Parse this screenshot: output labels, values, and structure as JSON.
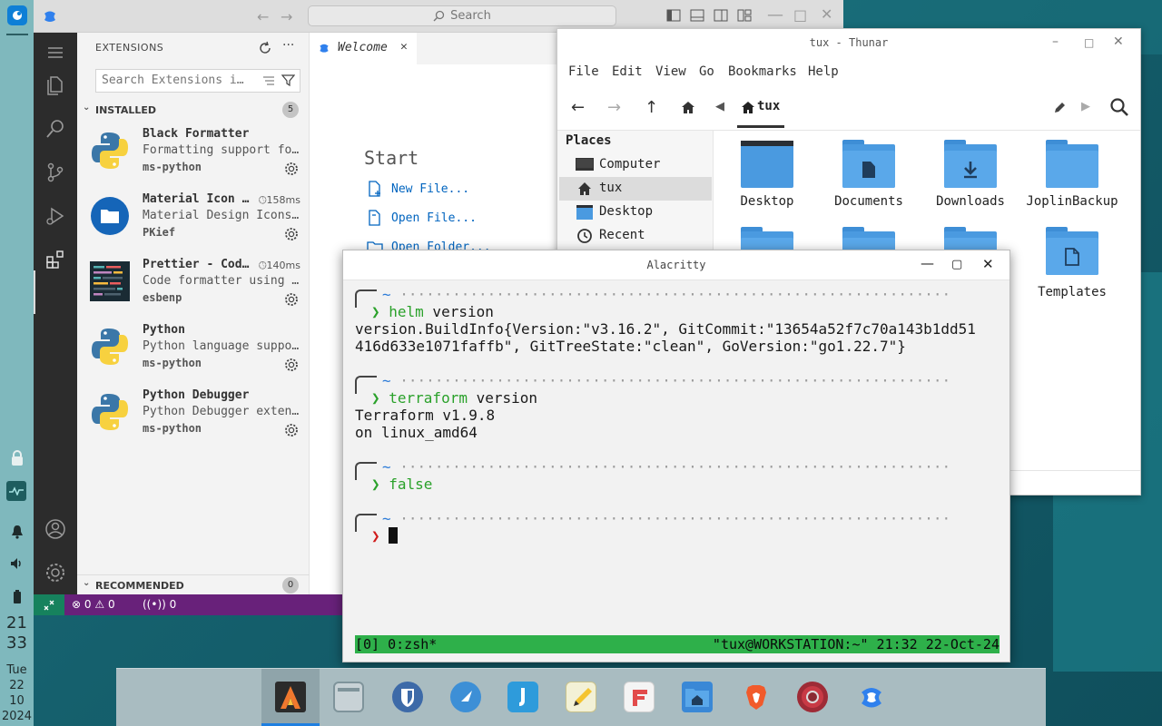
{
  "panel": {
    "clock_hour": "21",
    "clock_minute": "33",
    "date_day": "Tue",
    "date_dd": "22",
    "date_mm": "10",
    "date_yyyy": "2024"
  },
  "vscode": {
    "search_placeholder": "Search",
    "sidebar_title": "EXTENSIONS",
    "search_extensions_placeholder": "Search Extensions i…",
    "installed_label": "INSTALLED",
    "installed_count": "5",
    "recommended_label": "RECOMMENDED",
    "recommended_count": "0",
    "extensions": [
      {
        "name": "Black Formatter",
        "desc": "Formatting support fo…",
        "publisher": "ms-python",
        "time": "",
        "icon": "python-icon"
      },
      {
        "name": "Material Icon …",
        "desc": "Material Design Icons…",
        "publisher": "PKief",
        "time": "158ms",
        "icon": "folder-badge-icon"
      },
      {
        "name": "Prettier - Cod…",
        "desc": "Code formatter using …",
        "publisher": "esbenp",
        "time": "140ms",
        "icon": "prettier-icon"
      },
      {
        "name": "Python",
        "desc": "Python language suppo…",
        "publisher": "ms-python",
        "time": "",
        "icon": "python-icon"
      },
      {
        "name": "Python Debugger",
        "desc": "Python Debugger exten…",
        "publisher": "ms-python",
        "time": "",
        "icon": "python-icon"
      }
    ],
    "tab_label": "Welcome",
    "start_heading": "Start",
    "start_links": [
      "New File...",
      "Open File...",
      "Open Folder..."
    ],
    "status": {
      "errors": "0",
      "warnings": "0",
      "ports": "0"
    }
  },
  "thunar": {
    "title": "tux - Thunar",
    "menu": [
      "File",
      "Edit",
      "View",
      "Go",
      "Bookmarks",
      "Help"
    ],
    "path": "tux",
    "places_header": "Places",
    "places": [
      "Computer",
      "tux",
      "Desktop",
      "Recent"
    ],
    "files": [
      "Desktop",
      "Documents",
      "Downloads",
      "JoplinBackup",
      "Templates"
    ]
  },
  "alacritty": {
    "title": "Alacritty",
    "prompt_tilde": "~",
    "dots": "·······························································",
    "blocks": [
      {
        "cmd": "helm",
        "args": " version",
        "out": "version.BuildInfo{Version:\"v3.16.2\", GitCommit:\"13654a52f7c70a143b1dd51\n416d633e1071faffb\", GitTreeState:\"clean\", GoVersion:\"go1.22.7\"}"
      },
      {
        "cmd": "terraform",
        "args": " version",
        "out": "Terraform v1.9.8\non linux_amd64"
      },
      {
        "cmd": "false",
        "args": "",
        "out": ""
      }
    ],
    "tmux_left": "[0] 0:zsh*",
    "tmux_right": "\"tux@WORKSTATION:~\" 21:32 22-Oct-24"
  },
  "colors": {
    "vscode_status": "#68217a",
    "tmux_bar": "#2eb04a",
    "prompt_ok": "#2aa12a",
    "prompt_err": "#d01b1b"
  }
}
